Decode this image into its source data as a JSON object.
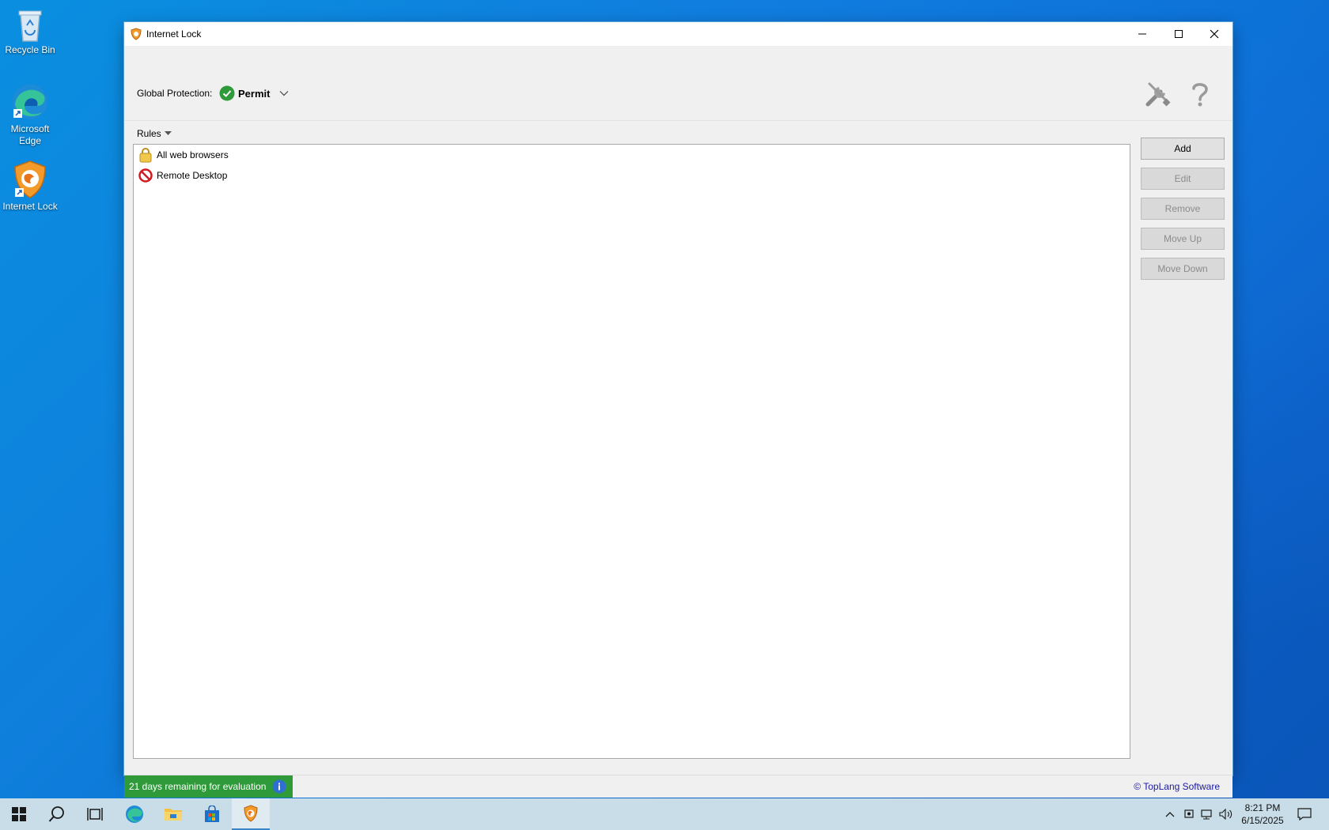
{
  "desktop": {
    "icons": [
      {
        "label": "Recycle Bin"
      },
      {
        "label": "Microsoft Edge"
      },
      {
        "label": "Internet Lock"
      }
    ]
  },
  "window": {
    "title": "Internet Lock",
    "global_protection": {
      "label": "Global Protection:",
      "value": "Permit",
      "status_color": "#2e9a3a"
    },
    "rules_header": "Rules",
    "rules": [
      {
        "name": "All web browsers",
        "icon": "lock-icon"
      },
      {
        "name": "Remote Desktop",
        "icon": "blocked-icon"
      }
    ],
    "buttons": {
      "add": "Add",
      "edit": "Edit",
      "remove": "Remove",
      "move_up": "Move Up",
      "move_down": "Move Down"
    },
    "status": {
      "evaluation": "21 days remaining for evaluation",
      "copyright": "© TopLang Software"
    }
  },
  "taskbar": {
    "clock_time": "8:21 PM",
    "clock_date": "6/15/2025"
  },
  "colors": {
    "accent": "#0a78d7",
    "eval_bar": "#2e9a3a",
    "link": "#1a1aa0"
  }
}
